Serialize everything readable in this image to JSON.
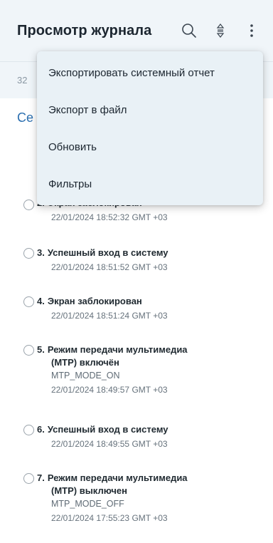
{
  "appbar": {
    "title": "Просмотр журнала",
    "icons": [
      "search-icon",
      "sort-icon",
      "more-vert-icon"
    ]
  },
  "subheader": {
    "text": "32"
  },
  "section": {
    "title": "Се"
  },
  "menu": {
    "items": [
      {
        "label": "Экспортировать системный отчет"
      },
      {
        "label": "Экспорт в файл"
      },
      {
        "label": "Обновить"
      },
      {
        "label": "Фильтры"
      }
    ]
  },
  "entries": [
    {
      "num": "2.",
      "title": "Экран заблокирован",
      "date": "22/01/2024 18:52:32 GMT +03"
    },
    {
      "num": "3.",
      "title": "Успешный вход в систему",
      "date": "22/01/2024 18:51:52 GMT +03"
    },
    {
      "num": "4.",
      "title": "Экран заблокирован",
      "date": "22/01/2024 18:51:24 GMT +03"
    },
    {
      "num": "5.",
      "title": "Режим передачи мультимедиа",
      "title2": "(MTP) включён",
      "code": "MTP_MODE_ON",
      "date": "22/01/2024 18:49:57 GMT +03"
    },
    {
      "num": "6.",
      "title": "Успешный вход в систему",
      "date": "22/01/2024 18:49:55 GMT +03"
    },
    {
      "num": "7.",
      "title": "Режим передачи мультимедиа",
      "title2": "(MTP) выключен",
      "code": "MTP_MODE_OFF",
      "date": "22/01/2024 17:55:23 GMT +03"
    }
  ],
  "colors": {
    "appbar_bg": "#f0f5f9",
    "menu_bg": "#e9f1f6",
    "accent": "#2b6fb0"
  }
}
